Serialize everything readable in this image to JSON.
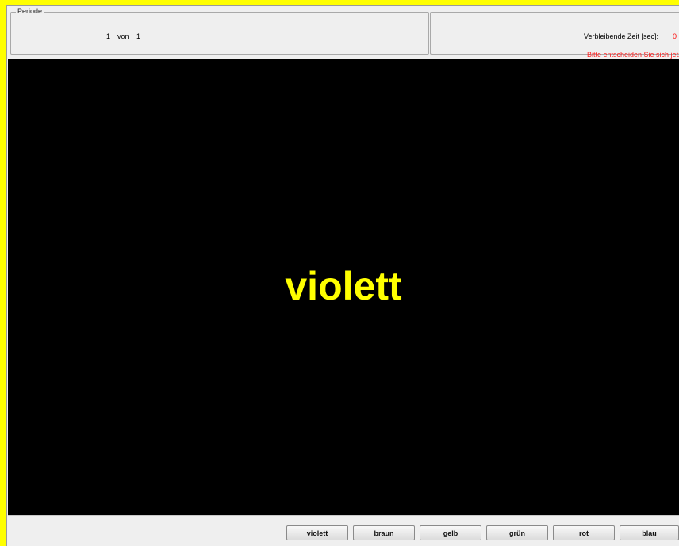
{
  "period": {
    "title": "Periode",
    "current": "1",
    "von_label": "von",
    "total": "1"
  },
  "timer": {
    "label": "Verbleibende Zeit [sec]:",
    "value": "0",
    "warning": "Bitte entscheiden Sie sich jetzt"
  },
  "stimulus": {
    "word": "violett",
    "color": "#ffff00"
  },
  "buttons": [
    {
      "label": "violett"
    },
    {
      "label": "braun"
    },
    {
      "label": "gelb"
    },
    {
      "label": "grün"
    },
    {
      "label": "rot"
    },
    {
      "label": "blau"
    }
  ],
  "colors": {
    "frame": "#ffff00",
    "stage_bg": "#000000",
    "warning": "#ff0000"
  }
}
